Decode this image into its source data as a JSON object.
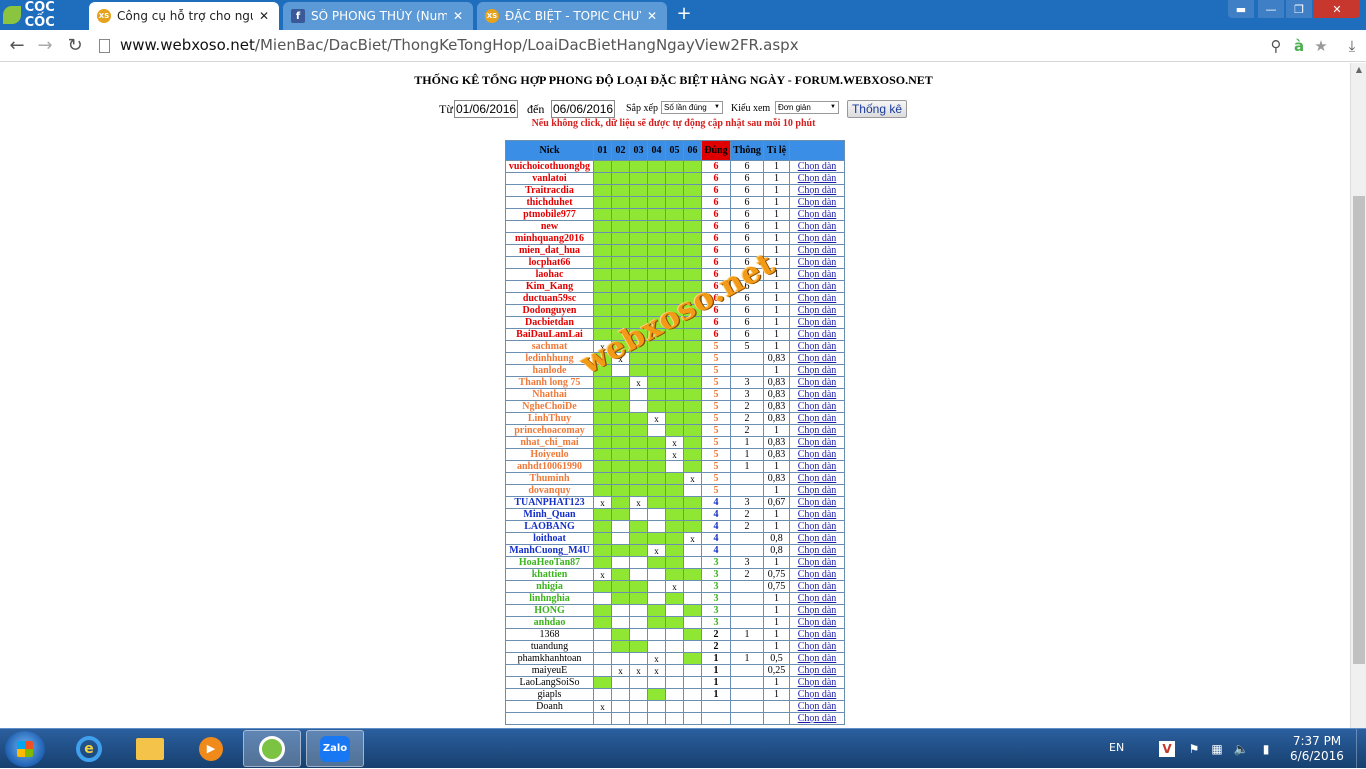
{
  "browser": {
    "logo_text": "CỐC CỐC",
    "tabs": [
      {
        "title": "Công cụ hỗ trợ cho người",
        "favicon": "XS",
        "active": true
      },
      {
        "title": "SỐ PHONG THỦY (Numero",
        "favicon": "f",
        "active": false
      },
      {
        "title": "ĐẶC BIỆT - TOPIC CHUYÊN",
        "favicon": "XS",
        "active": false
      }
    ],
    "close_glyph": "✕",
    "url_host": "www.webxoso.net",
    "url_path": "/MienBac/DacBiet/ThongKeTongHop/LoaiDacBietHangNgayView2FR.aspx"
  },
  "page": {
    "title": "THỐNG KÊ TỔNG HỢP PHONG ĐỘ LOẠI ĐẶC BIỆT HÀNG NGÀY - FORUM.WEBXOSO.NET",
    "filter": {
      "from_label": "Từ",
      "from_value": "01/06/2016",
      "to_label": "đến",
      "to_value": "06/06/2016",
      "sort_label": "Sắp xếp",
      "sort_value": "Số lần đúng",
      "view_label": "Kiểu xem",
      "view_value": "Đơn giản",
      "submit_label": "Thống kê"
    },
    "auto_note": "Nếu không click, dữ liệu sẽ được tự động cập nhật sau mỗi 10 phút",
    "watermark": "webxoso.net",
    "table": {
      "headers": [
        "Nick",
        "01",
        "02",
        "03",
        "04",
        "05",
        "06",
        "Đúng",
        "Thông",
        "Tỉ lệ",
        ""
      ],
      "link_label": "Chọn dàn",
      "rows": [
        {
          "nick": "vuichoicothuongbg",
          "days": [
            "g",
            "g",
            "g",
            "g",
            "g",
            "g"
          ],
          "dung": "6",
          "thong": "6",
          "tile": "1"
        },
        {
          "nick": "vanlatoi",
          "days": [
            "g",
            "g",
            "g",
            "g",
            "g",
            "g"
          ],
          "dung": "6",
          "thong": "6",
          "tile": "1"
        },
        {
          "nick": "Traitracdia",
          "days": [
            "g",
            "g",
            "g",
            "g",
            "g",
            "g"
          ],
          "dung": "6",
          "thong": "6",
          "tile": "1"
        },
        {
          "nick": "thichduhet",
          "days": [
            "g",
            "g",
            "g",
            "g",
            "g",
            "g"
          ],
          "dung": "6",
          "thong": "6",
          "tile": "1"
        },
        {
          "nick": "ptmobile977",
          "days": [
            "g",
            "g",
            "g",
            "g",
            "g",
            "g"
          ],
          "dung": "6",
          "thong": "6",
          "tile": "1"
        },
        {
          "nick": "new",
          "days": [
            "g",
            "g",
            "g",
            "g",
            "g",
            "g"
          ],
          "dung": "6",
          "thong": "6",
          "tile": "1"
        },
        {
          "nick": "minhquang2016",
          "days": [
            "g",
            "g",
            "g",
            "g",
            "g",
            "g"
          ],
          "dung": "6",
          "thong": "6",
          "tile": "1"
        },
        {
          "nick": "mien_dat_hua",
          "days": [
            "g",
            "g",
            "g",
            "g",
            "g",
            "g"
          ],
          "dung": "6",
          "thong": "6",
          "tile": "1"
        },
        {
          "nick": "locphat66",
          "days": [
            "g",
            "g",
            "g",
            "g",
            "g",
            "g"
          ],
          "dung": "6",
          "thong": "6",
          "tile": "1"
        },
        {
          "nick": "laohac",
          "days": [
            "g",
            "g",
            "g",
            "g",
            "g",
            "g"
          ],
          "dung": "6",
          "thong": "6",
          "tile": "1"
        },
        {
          "nick": "Kim_Kang",
          "days": [
            "g",
            "g",
            "g",
            "g",
            "g",
            "g"
          ],
          "dung": "6",
          "thong": "6",
          "tile": "1"
        },
        {
          "nick": "ductuan59sc",
          "days": [
            "g",
            "g",
            "g",
            "g",
            "g",
            "g"
          ],
          "dung": "6",
          "thong": "6",
          "tile": "1"
        },
        {
          "nick": "Dodonguyen",
          "days": [
            "g",
            "g",
            "g",
            "g",
            "g",
            "g"
          ],
          "dung": "6",
          "thong": "6",
          "tile": "1"
        },
        {
          "nick": "Dacbietdan",
          "days": [
            "g",
            "g",
            "g",
            "g",
            "g",
            "g"
          ],
          "dung": "6",
          "thong": "6",
          "tile": "1"
        },
        {
          "nick": "BaiDauLamLai",
          "days": [
            "g",
            "g",
            "g",
            "g",
            "g",
            "g"
          ],
          "dung": "6",
          "thong": "6",
          "tile": "1"
        },
        {
          "nick": "sachmat",
          "days": [
            "x",
            "g",
            "g",
            "g",
            "g",
            "g"
          ],
          "dung": "5",
          "thong": "5",
          "tile": "1"
        },
        {
          "nick": "ledinhhung",
          "days": [
            "g",
            "x",
            "g",
            "g",
            "g",
            "g"
          ],
          "dung": "5",
          "thong": "",
          "tile": "0,83"
        },
        {
          "nick": "hanlode",
          "days": [
            "g",
            "",
            "g",
            "g",
            "g",
            "g"
          ],
          "dung": "5",
          "thong": "",
          "tile": "1"
        },
        {
          "nick": "Thanh long 75",
          "days": [
            "g",
            "g",
            "x",
            "g",
            "g",
            "g"
          ],
          "dung": "5",
          "thong": "3",
          "tile": "0,83"
        },
        {
          "nick": "Nhathai",
          "days": [
            "g",
            "g",
            "",
            "g",
            "g",
            "g"
          ],
          "dung": "5",
          "thong": "3",
          "tile": "0,83"
        },
        {
          "nick": "NgheChoiDe",
          "days": [
            "g",
            "g",
            "",
            "g",
            "g",
            "g"
          ],
          "dung": "5",
          "thong": "2",
          "tile": "0,83"
        },
        {
          "nick": "LinhThuy",
          "days": [
            "g",
            "g",
            "g",
            "x",
            "g",
            "g"
          ],
          "dung": "5",
          "thong": "2",
          "tile": "0,83"
        },
        {
          "nick": "princehoacomay",
          "days": [
            "g",
            "g",
            "g",
            "",
            "g",
            "g"
          ],
          "dung": "5",
          "thong": "2",
          "tile": "1"
        },
        {
          "nick": "nhat_chi_mai",
          "days": [
            "g",
            "g",
            "g",
            "g",
            "x",
            "g"
          ],
          "dung": "5",
          "thong": "1",
          "tile": "0,83"
        },
        {
          "nick": "Hoiyeulo",
          "days": [
            "g",
            "g",
            "g",
            "g",
            "x",
            "g"
          ],
          "dung": "5",
          "thong": "1",
          "tile": "0,83"
        },
        {
          "nick": "anhdt10061990",
          "days": [
            "g",
            "g",
            "g",
            "g",
            "",
            "g"
          ],
          "dung": "5",
          "thong": "1",
          "tile": "1"
        },
        {
          "nick": "Thuminh",
          "days": [
            "g",
            "g",
            "g",
            "g",
            "g",
            "x"
          ],
          "dung": "5",
          "thong": "",
          "tile": "0,83"
        },
        {
          "nick": "dovanquy",
          "days": [
            "g",
            "g",
            "g",
            "g",
            "g",
            ""
          ],
          "dung": "5",
          "thong": "",
          "tile": "1"
        },
        {
          "nick": "TUANPHAT123",
          "days": [
            "x",
            "g",
            "x",
            "g",
            "g",
            "g"
          ],
          "dung": "4",
          "thong": "3",
          "tile": "0,67"
        },
        {
          "nick": "Minh_Quan",
          "days": [
            "g",
            "g",
            "",
            "",
            "g",
            "g"
          ],
          "dung": "4",
          "thong": "2",
          "tile": "1"
        },
        {
          "nick": "LAOBANG",
          "days": [
            "g",
            "",
            "g",
            "",
            "g",
            "g"
          ],
          "dung": "4",
          "thong": "2",
          "tile": "1"
        },
        {
          "nick": "loithoat",
          "days": [
            "g",
            "",
            "g",
            "g",
            "g",
            "x"
          ],
          "dung": "4",
          "thong": "",
          "tile": "0,8"
        },
        {
          "nick": "ManhCuong_M4U",
          "days": [
            "g",
            "g",
            "g",
            "x",
            "g",
            ""
          ],
          "dung": "4",
          "thong": "",
          "tile": "0,8"
        },
        {
          "nick": "HoaHeoTan87",
          "days": [
            "g",
            "",
            "",
            "g",
            "g",
            ""
          ],
          "dung": "3",
          "thong": "3",
          "tile": "1"
        },
        {
          "nick": "khattien",
          "days": [
            "x",
            "g",
            "",
            "",
            "g",
            "g"
          ],
          "dung": "3",
          "thong": "2",
          "tile": "0,75"
        },
        {
          "nick": "nhigia",
          "days": [
            "g",
            "g",
            "g",
            "",
            "x",
            ""
          ],
          "dung": "3",
          "thong": "",
          "tile": "0,75"
        },
        {
          "nick": "linhnghia",
          "days": [
            "",
            "g",
            "g",
            "",
            "g",
            ""
          ],
          "dung": "3",
          "thong": "",
          "tile": "1"
        },
        {
          "nick": "HONG",
          "days": [
            "g",
            "",
            "",
            "g",
            "",
            "g"
          ],
          "dung": "3",
          "thong": "",
          "tile": "1"
        },
        {
          "nick": "anhdao",
          "days": [
            "g",
            "",
            "",
            "g",
            "g",
            ""
          ],
          "dung": "3",
          "thong": "",
          "tile": "1"
        },
        {
          "nick": "1368",
          "days": [
            "",
            "g",
            "",
            "",
            "",
            "g"
          ],
          "dung": "2",
          "thong": "1",
          "tile": "1"
        },
        {
          "nick": "tuandung",
          "days": [
            "",
            "g",
            "g",
            "",
            "",
            ""
          ],
          "dung": "2",
          "thong": "",
          "tile": "1"
        },
        {
          "nick": "phamkhanhtoan",
          "days": [
            "",
            "",
            "",
            "x",
            "",
            "g"
          ],
          "dung": "1",
          "thong": "1",
          "tile": "0,5"
        },
        {
          "nick": "maiyeuE",
          "days": [
            "",
            "x",
            "x",
            "x",
            "",
            ""
          ],
          "dung": "1",
          "thong": "",
          "tile": "0,25"
        },
        {
          "nick": "LaoLangSoiSo",
          "days": [
            "g",
            "",
            "",
            "",
            "",
            ""
          ],
          "dung": "1",
          "thong": "",
          "tile": "1"
        },
        {
          "nick": "giapls",
          "days": [
            "",
            "",
            "",
            "g",
            "",
            ""
          ],
          "dung": "1",
          "thong": "",
          "tile": "1"
        },
        {
          "nick": "Doanh",
          "days": [
            "x",
            "",
            "",
            "",
            "",
            ""
          ],
          "dung": "",
          "thong": "",
          "tile": ""
        },
        {
          "nick": "",
          "days": [
            "",
            "",
            "",
            "",
            "",
            ""
          ],
          "dung": "",
          "thong": "",
          "tile": ""
        }
      ]
    }
  },
  "taskbar": {
    "zalo_label": "Zalo",
    "language": "EN",
    "time": "7:37 PM",
    "date": "6/6/2016"
  }
}
